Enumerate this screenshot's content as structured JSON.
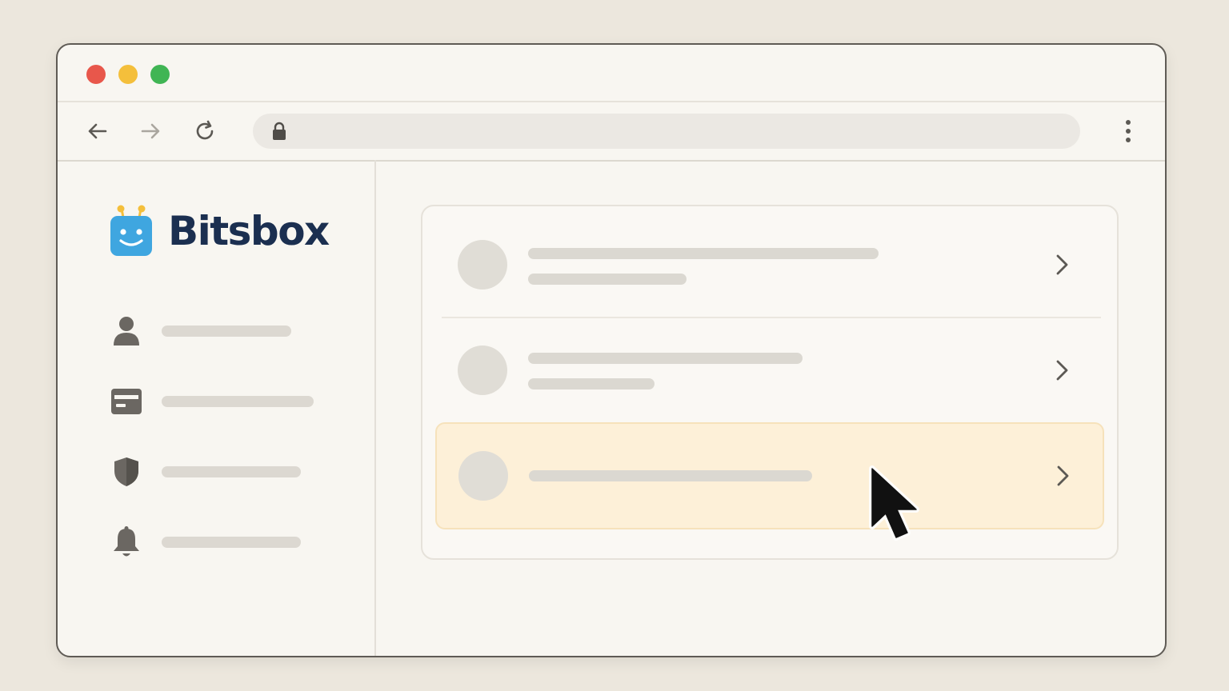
{
  "browser": {
    "window_controls": [
      "close",
      "minimize",
      "maximize"
    ],
    "url": "",
    "nav_icons": [
      "back-arrow-icon",
      "forward-arrow-icon",
      "reload-icon",
      "lock-icon",
      "kebab-menu-icon"
    ]
  },
  "logo": {
    "text": "Bitsbox",
    "icon": "robot-face-icon",
    "colors": {
      "icon": "#3fa6e0",
      "text": "#1b2f50",
      "antenna": "#f4bf3b"
    }
  },
  "sidebar": {
    "items": [
      {
        "icon": "user-icon",
        "label": ""
      },
      {
        "icon": "credit-card-icon",
        "label": ""
      },
      {
        "icon": "shield-icon",
        "label": ""
      },
      {
        "icon": "bell-icon",
        "label": ""
      }
    ]
  },
  "list": {
    "rows": [
      {
        "title": "",
        "subtitle": "",
        "highlighted": false
      },
      {
        "title": "",
        "subtitle": "",
        "highlighted": false
      },
      {
        "title": "",
        "highlighted": true
      }
    ],
    "highlight_color": "#fdf0d8"
  },
  "cursor": "arrow-pointer-icon"
}
